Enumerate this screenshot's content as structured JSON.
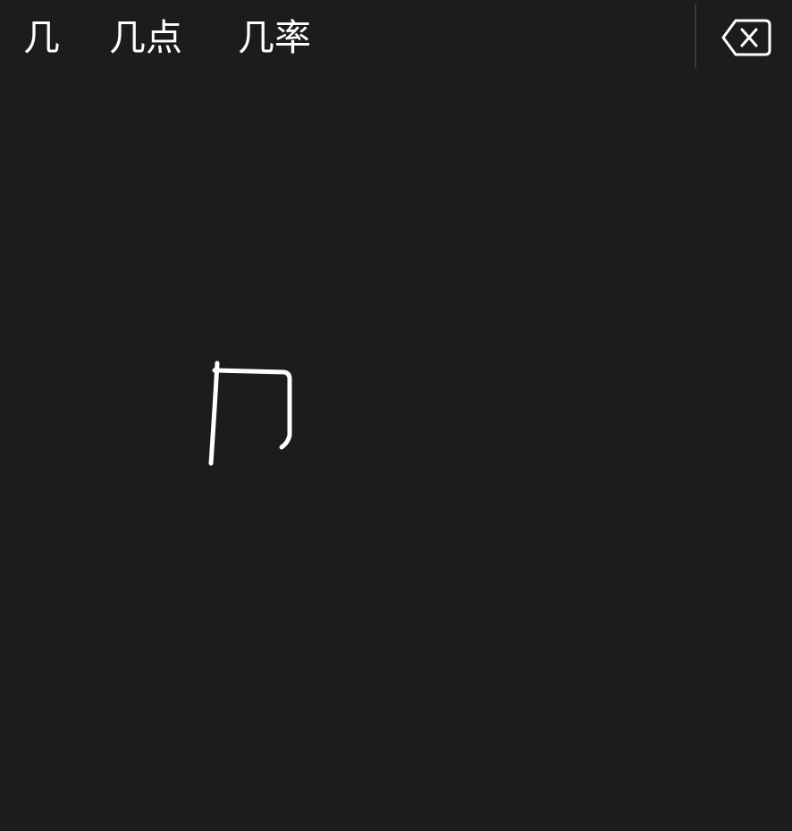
{
  "candidate_bar": {
    "candidates": [
      "几",
      "几点",
      "几率"
    ]
  },
  "delete_button": {
    "icon": "backspace-icon"
  },
  "handwriting": {
    "stroke_color": "#ffffff",
    "background_color": "#1c1b1e"
  }
}
